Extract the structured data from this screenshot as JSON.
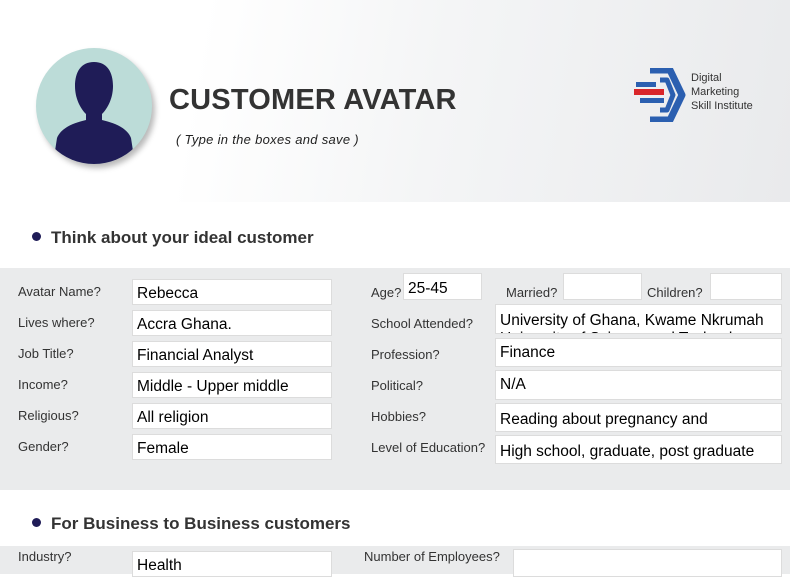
{
  "header": {
    "title": "CUSTOMER AVATAR",
    "subtitle": "( Type in the boxes and save )",
    "logo_lines": [
      "Digital",
      "Marketing",
      "Skill Institute"
    ]
  },
  "section1": {
    "heading": "Think about your ideal customer",
    "left_fields": [
      {
        "label": "Avatar Name?",
        "value": "Rebecca"
      },
      {
        "label": "Lives where?",
        "value": "Accra Ghana."
      },
      {
        "label": "Job Title?",
        "value": "Financial Analyst"
      },
      {
        "label": "Income?",
        "value": "Middle - Upper middle"
      },
      {
        "label": "Religious?",
        "value": "All religion"
      },
      {
        "label": "Gender?",
        "value": "Female"
      }
    ],
    "age": {
      "label": "Age?",
      "value": "25-45"
    },
    "married": {
      "label": "Married?",
      "value": ""
    },
    "children": {
      "label": "Children?",
      "value": ""
    },
    "school": {
      "label": "School Attended?",
      "value": "University of Ghana, Kwame Nkrumah University of Science and Technology"
    },
    "profession": {
      "label": "Profession?",
      "value": "Finance"
    },
    "political": {
      "label": "Political?",
      "value": "N/A"
    },
    "hobbies": {
      "label": "Hobbies?",
      "value": "Reading about pregnancy and"
    },
    "education": {
      "label": "Level of Education?",
      "value": "High school, graduate, post graduate"
    }
  },
  "section2": {
    "heading": "For Business to Business customers",
    "industry": {
      "label": "Industry?",
      "value": "Health"
    },
    "employees": {
      "label": "Number of Employees?",
      "value": ""
    }
  },
  "colors": {
    "accent_navy": "#1f1c57",
    "logo_blue": "#2b5fb0",
    "logo_red": "#d9262a",
    "avatar_bg": "#bcdcd8",
    "band_bg": "#eaebec"
  }
}
